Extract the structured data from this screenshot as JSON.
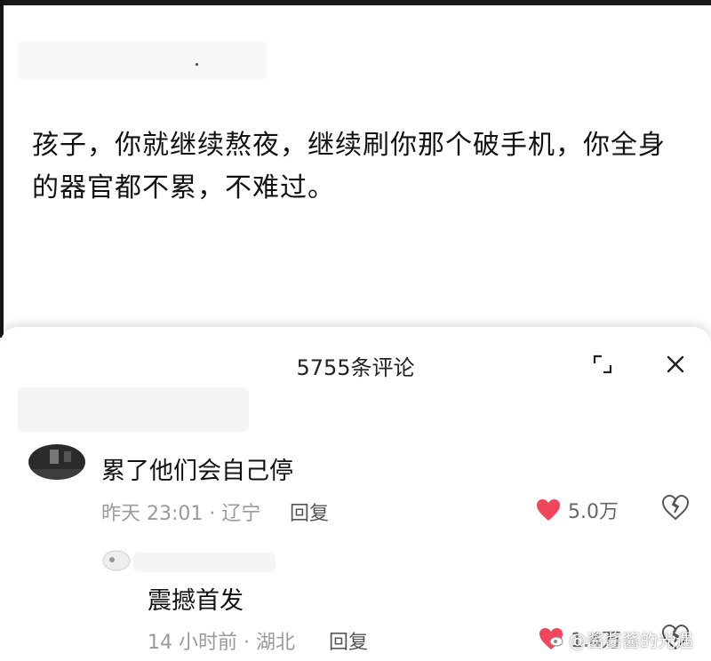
{
  "post": {
    "text": "孩子，你就继续熬夜，继续刷你那个破手机，你全身的器官都不累，不难过。"
  },
  "comments_sheet": {
    "title": "5755条评论",
    "expand_icon": "expand-icon",
    "close_icon": "close-icon"
  },
  "comments": [
    {
      "text": "累了他们会自己停",
      "meta": "昨天 23:01 · 辽宁",
      "reply_label": "回复",
      "likes": "5.0万",
      "liked": true
    },
    {
      "text": "震撼首发",
      "meta": "14 小时前 · 湖北",
      "reply_label": "回复",
      "likes": "1.4万",
      "liked": true
    }
  ],
  "watermark": {
    "text": "@酱酱酱的光遇"
  },
  "colors": {
    "like_heart": "#f0455a",
    "meta_text": "#9a9a9a"
  }
}
